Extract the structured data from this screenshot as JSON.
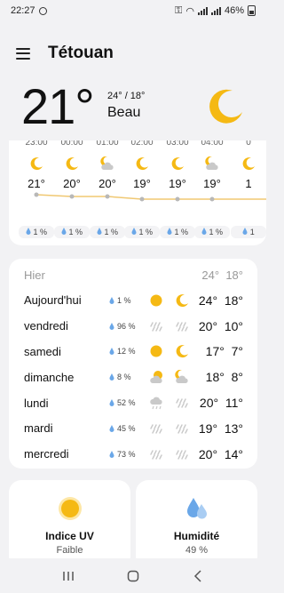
{
  "status_bar": {
    "time": "22:27",
    "battery": "46%"
  },
  "header": {
    "city": "Tétouan"
  },
  "current": {
    "temperature": "21°",
    "hi_lo": "24° / 18°",
    "condition": "Beau"
  },
  "hourly": [
    {
      "time": "23:00",
      "icon": "moon-icon",
      "temp": "21°",
      "rain": "1 %"
    },
    {
      "time": "00:00",
      "icon": "moon-icon",
      "temp": "20°",
      "rain": "1 %"
    },
    {
      "time": "01:00",
      "icon": "moon-cloud-icon",
      "temp": "20°",
      "rain": "1 %"
    },
    {
      "time": "02:00",
      "icon": "moon-icon",
      "temp": "19°",
      "rain": "1 %"
    },
    {
      "time": "03:00",
      "icon": "moon-icon",
      "temp": "19°",
      "rain": "1 %"
    },
    {
      "time": "04:00",
      "icon": "moon-cloud-icon",
      "temp": "19°",
      "rain": "1 %"
    },
    {
      "time": "0",
      "icon": "moon-icon",
      "temp": "1",
      "rain": "1"
    }
  ],
  "daily": [
    {
      "day": "Hier",
      "rain": "",
      "day_icon": "",
      "night_icon": "",
      "hi": "24°",
      "lo": "18°",
      "past": true
    },
    {
      "day": "Aujourd'hui",
      "rain": "1 %",
      "day_icon": "sun-icon",
      "night_icon": "moon-icon",
      "hi": "24°",
      "lo": "18°"
    },
    {
      "day": "vendredi",
      "rain": "96 %",
      "day_icon": "rain-icon",
      "night_icon": "rain-icon",
      "hi": "20°",
      "lo": "10°"
    },
    {
      "day": "samedi",
      "rain": "12 %",
      "day_icon": "sun-icon",
      "night_icon": "moon-icon",
      "hi": "17°",
      "lo": "7°"
    },
    {
      "day": "dimanche",
      "rain": "8 %",
      "day_icon": "sun-cloud-icon",
      "night_icon": "moon-cloud-icon",
      "hi": "18°",
      "lo": "8°"
    },
    {
      "day": "lundi",
      "rain": "52 %",
      "day_icon": "cloud-rain-icon",
      "night_icon": "rain-icon",
      "hi": "20°",
      "lo": "11°"
    },
    {
      "day": "mardi",
      "rain": "45 %",
      "day_icon": "rain-icon",
      "night_icon": "rain-icon",
      "hi": "19°",
      "lo": "13°"
    },
    {
      "day": "mercredi",
      "rain": "73 %",
      "day_icon": "rain-icon",
      "night_icon": "rain-icon",
      "hi": "20°",
      "lo": "14°"
    }
  ],
  "cards": [
    {
      "title": "Indice UV",
      "value": "Faible",
      "icon": "sun-icon"
    },
    {
      "title": "Humidité",
      "value": "49 %",
      "icon": "humidity-drops-icon"
    }
  ],
  "colors": {
    "accent_yellow": "#f5b914",
    "drop_blue": "#6aa7e8",
    "line": "#f0c872"
  }
}
